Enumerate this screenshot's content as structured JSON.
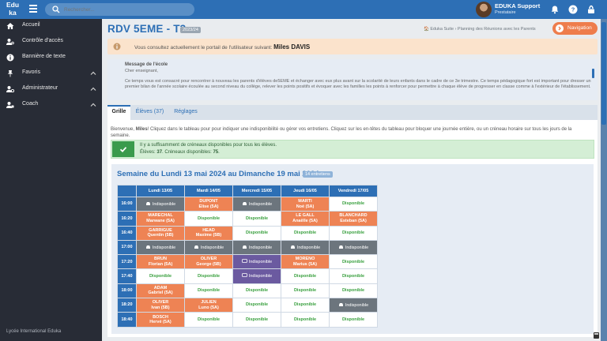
{
  "topbar": {
    "logo_line1": "Edu",
    "logo_line2": "ka",
    "search_placeholder": "Rechercher...",
    "user_name": "EDUKA Support",
    "user_role": "Prestataire"
  },
  "sidebar": {
    "items": [
      {
        "label": "Accueil",
        "icon": "home-icon"
      },
      {
        "label": "Contrôle d'accès",
        "icon": "user-key-icon"
      },
      {
        "label": "Bannière de texte",
        "icon": "info-circle-icon"
      },
      {
        "label": "Favoris",
        "icon": "pin-icon",
        "chevron": true
      },
      {
        "label": "Administrateur",
        "icon": "admin-user-icon",
        "chevron": true
      },
      {
        "label": "Coach",
        "icon": "coach-user-icon",
        "chevron": true
      }
    ],
    "footer": "Lycée International Eduka"
  },
  "header": {
    "title": "RDV 5EME - T3",
    "year_badge": "2023/24",
    "breadcrumb": "🏠 Eduka Suite › Planning des Réunions avec les Parents",
    "nav_button": "Navigation"
  },
  "alert": {
    "text": "Vous consultez actuellement le portail de l'utilisateur suivant:",
    "user": "Miles DAVIS"
  },
  "school_message": {
    "heading": "Message de l'école",
    "greeting": "Cher enseignant,",
    "body": "Ce temps vous est consacré pour rencontrer à nouveau les parents d'élèves de5EME et échanger avec eux plus avant sur la scolarité de leurs enfants dans le cadre de ce 3e trimestre. Ce temps pédagogique fort est important pour dresser un premier bilan de l'année scolaire écoulée au second niveau du collège, relever les points positifs et évoquer avec les familles les points à renforcer pour permettre à chaque élève de progresser en classe comme à l'extérieur de l'établissement."
  },
  "tabs": [
    {
      "label": "Grille",
      "active": true
    },
    {
      "label": "Élèves (37)",
      "active": false
    },
    {
      "label": "Réglages",
      "active": false
    }
  ],
  "intro": {
    "prefix": "Bienvenue, ",
    "name": "Miles",
    "text": "! Cliquez dans le tableau pour pour indiquer une indisponibilité ou gérer vos entretiens. Cliquez sur les en-têtes du tableau pour bloquer une journée entière, ou un créneau horaire sur tous les jours de la semaine."
  },
  "success": {
    "line1": "Il y a suffisamment de créneaux disponibles pour tous les élèves.",
    "students_label": "Élèves:",
    "students": "37",
    "slots_label": "Créneaux disponibles:",
    "slots": "75"
  },
  "week": {
    "title": "Semaine du Lundi 13 mai 2024 au Dimanche 19 mai 2024",
    "badge": "14 entretiens",
    "days": [
      "Lundi 13/05",
      "Mardi 14/05",
      "Mercredi 15/05",
      "Jeudi 16/05",
      "Vendredi 17/05"
    ],
    "rows": [
      {
        "time": "16:00",
        "cells": [
          {
            "s": "unav",
            "l1": "Indisponible"
          },
          {
            "s": "booked",
            "l1": "DUPONT",
            "l2": "Elise (5A)"
          },
          {
            "s": "unav",
            "l1": "Indisponible"
          },
          {
            "s": "booked",
            "l1": "MARTI",
            "l2": "Noé (5A)"
          },
          {
            "s": "open",
            "l1": "Disponible"
          }
        ]
      },
      {
        "time": "16:20",
        "cells": [
          {
            "s": "booked",
            "l1": "MARECHAL",
            "l2": "Marwane (5A)"
          },
          {
            "s": "open",
            "l1": "Disponible"
          },
          {
            "s": "open",
            "l1": "Disponible"
          },
          {
            "s": "booked",
            "l1": "LE GALL",
            "l2": "Anaëlle (5A)"
          },
          {
            "s": "booked",
            "l1": "BLANCHARD",
            "l2": "Esteban (5A)"
          }
        ]
      },
      {
        "time": "16:40",
        "cells": [
          {
            "s": "booked",
            "l1": "GARRIGUE",
            "l2": "Quentin (5B)"
          },
          {
            "s": "booked",
            "l1": "HEAD",
            "l2": "Maxime (5B)"
          },
          {
            "s": "open",
            "l1": "Disponible"
          },
          {
            "s": "open",
            "l1": "Disponible"
          },
          {
            "s": "open",
            "l1": "Disponible"
          }
        ]
      },
      {
        "time": "17:00",
        "cells": [
          {
            "s": "unav",
            "l1": "Indisponible"
          },
          {
            "s": "unav",
            "l1": "Indisponible"
          },
          {
            "s": "unav",
            "l1": "Indisponible"
          },
          {
            "s": "unav",
            "l1": "Indisponible"
          },
          {
            "s": "unav",
            "l1": "Indisponible"
          }
        ]
      },
      {
        "time": "17:20",
        "cells": [
          {
            "s": "booked",
            "l1": "BRUN",
            "l2": "Florian (5A)"
          },
          {
            "s": "booked",
            "l1": "OLIVER",
            "l2": "George (5B)"
          },
          {
            "s": "conf",
            "l1": "Indisponible"
          },
          {
            "s": "booked",
            "l1": "MORENO",
            "l2": "Marius (5A)"
          },
          {
            "s": "open",
            "l1": "Disponible"
          }
        ]
      },
      {
        "time": "17:40",
        "cells": [
          {
            "s": "open",
            "l1": "Disponible"
          },
          {
            "s": "open",
            "l1": "Disponible"
          },
          {
            "s": "conf",
            "l1": "Indisponible"
          },
          {
            "s": "open",
            "l1": "Disponible"
          },
          {
            "s": "open",
            "l1": "Disponible"
          }
        ]
      },
      {
        "time": "18:00",
        "cells": [
          {
            "s": "booked",
            "l1": "ADAM",
            "l2": "Gabriel (5A)"
          },
          {
            "s": "open",
            "l1": "Disponible"
          },
          {
            "s": "open",
            "l1": "Disponible"
          },
          {
            "s": "open",
            "l1": "Disponible"
          },
          {
            "s": "open",
            "l1": "Disponible"
          }
        ]
      },
      {
        "time": "18:20",
        "cells": [
          {
            "s": "booked",
            "l1": "OLIVER",
            "l2": "Ivan (5B)"
          },
          {
            "s": "booked",
            "l1": "JULIEN",
            "l2": "Luno (5A)"
          },
          {
            "s": "open",
            "l1": "Disponible"
          },
          {
            "s": "open",
            "l1": "Disponible"
          },
          {
            "s": "unav",
            "l1": "Indisponible"
          }
        ]
      },
      {
        "time": "18:40",
        "cells": [
          {
            "s": "booked",
            "l1": "BOSCH",
            "l2": "Hervé (5A)"
          },
          {
            "s": "open",
            "l1": "Disponible"
          },
          {
            "s": "open",
            "l1": "Disponible"
          },
          {
            "s": "open",
            "l1": "Disponible"
          },
          {
            "s": "open",
            "l1": "Disponible"
          }
        ]
      }
    ]
  },
  "colors": {
    "primary": "#2d6fb5",
    "sidebar": "#282c36",
    "booked": "#ee8354",
    "unavailable": "#6c757d",
    "conference": "#6b5aa0",
    "available": "#3aa03f",
    "success_bg": "#d4eed5"
  }
}
